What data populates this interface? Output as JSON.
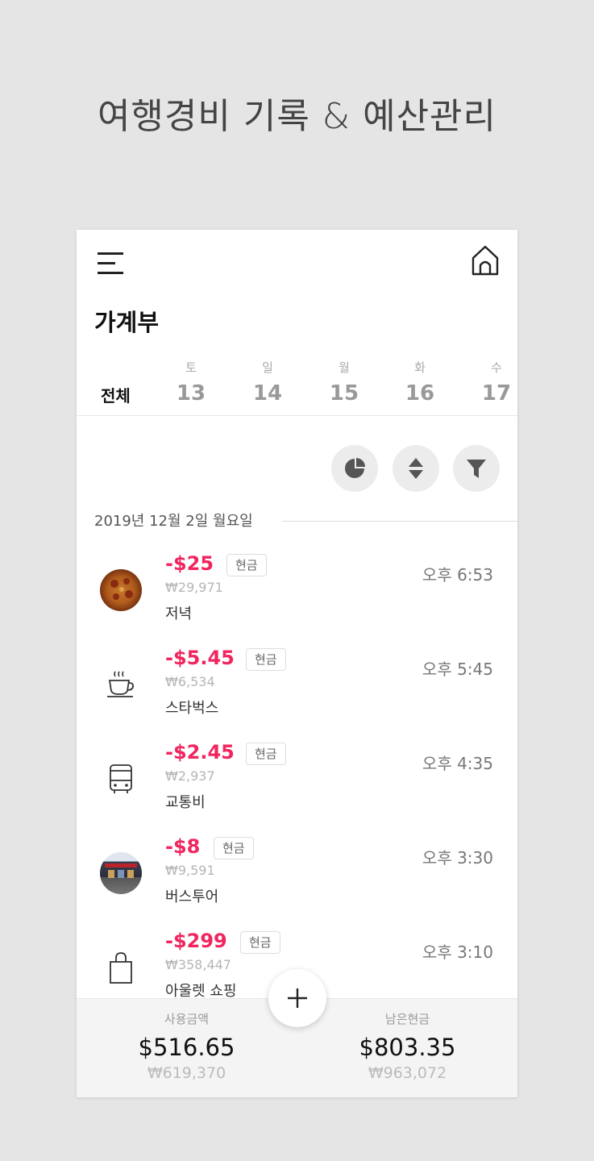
{
  "promo": {
    "headline": "여행경비 기록 & 예산관리"
  },
  "header": {
    "title": "가계부"
  },
  "days": {
    "all_label": "전체",
    "items": [
      {
        "dow": "토",
        "num": "13"
      },
      {
        "dow": "일",
        "num": "14"
      },
      {
        "dow": "월",
        "num": "15"
      },
      {
        "dow": "화",
        "num": "16"
      },
      {
        "dow": "수",
        "num": "17"
      }
    ]
  },
  "list": {
    "date_header": "2019년 12월 2일 월요일",
    "items": [
      {
        "amount": "-$25",
        "tag": "현금",
        "krw": "₩29,971",
        "memo": "저녁",
        "time": "오후 6:53",
        "icon": "pizza-photo"
      },
      {
        "amount": "-$5.45",
        "tag": "현금",
        "krw": "₩6,534",
        "memo": "스타벅스",
        "time": "오후 5:45",
        "icon": "coffee-cup-icon"
      },
      {
        "amount": "-$2.45",
        "tag": "현금",
        "krw": "₩2,937",
        "memo": "교통비",
        "time": "오후 4:35",
        "icon": "bus-icon"
      },
      {
        "amount": "-$8",
        "tag": "현금",
        "krw": "₩9,591",
        "memo": "버스투어",
        "time": "오후 3:30",
        "icon": "store-photo"
      },
      {
        "amount": "-$299",
        "tag": "현금",
        "krw": "₩358,447",
        "memo": "아울렛 쇼핑",
        "time": "오후 3:10",
        "icon": "shopping-bag-icon"
      }
    ]
  },
  "footer": {
    "spent": {
      "label": "사용금액",
      "usd": "$516.65",
      "krw": "₩619,370"
    },
    "remaining": {
      "label": "남은현금",
      "usd": "$803.35",
      "krw": "₩963,072"
    }
  },
  "colors": {
    "amount": "#f0265e",
    "background": "#e5e5e5"
  }
}
